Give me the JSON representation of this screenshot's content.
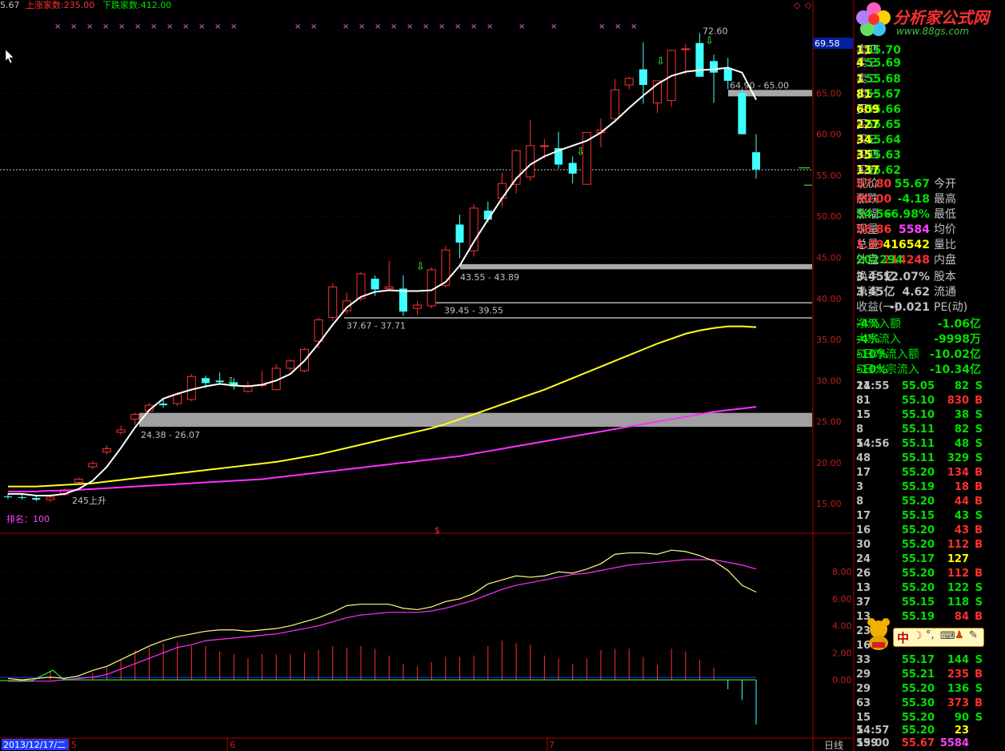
{
  "top_left": {
    "value": "5.67",
    "rise_label": "上涨家数:",
    "rise_value": "235.00",
    "fall_label": "下跌家数:",
    "fall_value": "412.00"
  },
  "logo": {
    "title": "分析家公式网",
    "url": "www.88gs.com"
  },
  "price_axis": {
    "current_box": "69.58",
    "ticks": [
      "65.00",
      "60.00",
      "55.00",
      "50.00",
      "45.00",
      "40.00",
      "35.00",
      "30.00",
      "25.00",
      "20.00",
      "15.00"
    ]
  },
  "indicator_axis": {
    "ticks": [
      "8.00",
      "6.00",
      "4.00",
      "2.00",
      "0.00"
    ]
  },
  "annotations": {
    "peak": "72.60",
    "z1": "64.90 - 65.00",
    "z2": "43.55 - 43.89",
    "z3": "39.45 - 39.55",
    "z4": "37.67 - 37.71",
    "z5": "24.38 - 26.07",
    "rise_note": "245上升",
    "rank": "排名：100",
    "dollar": "$"
  },
  "bottom_bar": {
    "date": "2013/12/17/二",
    "m1": "5",
    "m2": "6",
    "m3": "7",
    "period": "日线"
  },
  "order_book": [
    {
      "label": "卖四",
      "price": "55.70",
      "vol": "11"
    },
    {
      "label": "卖三",
      "price": "55.69",
      "vol": "4"
    },
    {
      "label": "卖二",
      "price": "55.68",
      "vol": "1"
    },
    {
      "label": "卖一",
      "price": "55.67",
      "vol": "81"
    },
    {
      "label": "买一",
      "price": "55.66",
      "vol": "609"
    },
    {
      "label": "买二",
      "price": "55.65",
      "vol": "227"
    },
    {
      "label": "买三",
      "price": "55.64",
      "vol": "34"
    },
    {
      "label": "买四",
      "price": "55.63",
      "vol": "35"
    },
    {
      "label": "买五",
      "price": "55.62",
      "vol": "137"
    }
  ],
  "stats": [
    {
      "l1": "现价",
      "v1": "55.67",
      "l2": "今开",
      "v2": "57.80",
      "c1": "#00e000",
      "c2": "#ff3030"
    },
    {
      "l1": "涨跌",
      "v1": "-4.18",
      "l2": "最高",
      "v2": "60.00",
      "c1": "#00e000",
      "c2": "#ff3030"
    },
    {
      "l1": "涨幅",
      "v1": "-6.98%",
      "l2": "最低",
      "v2": "54.56",
      "c1": "#00e000",
      "c2": "#00e000"
    },
    {
      "l1": "现量",
      "v1": "5584",
      "l2": "均价",
      "v2": "56.86",
      "c1": "#ff40ff",
      "c2": "#ff3030"
    },
    {
      "l1": "总量",
      "v1": "416542",
      "l2": "量比",
      "v2": "1.39",
      "c1": "#ffff00",
      "c2": "#ff3030"
    },
    {
      "l1": "外盘",
      "v1": "214248",
      "l2": "内盘",
      "v2": "202294",
      "c1": "#ff3030",
      "c2": "#00e000"
    },
    {
      "l1": "换手",
      "v1": "12.07%",
      "l2": "股本",
      "v2": "3.45亿",
      "c1": "#c0c0c0",
      "c2": "#c0c0c0"
    },
    {
      "l1": "净资",
      "v1": "4.62",
      "l2": "流通",
      "v2": "3.45亿",
      "c1": "#c0c0c0",
      "c2": "#c0c0c0"
    },
    {
      "l1": "收益(一)",
      "v1": "-0.021",
      "l2": "PE(动)",
      "v2": "",
      "c1": "#c0c0c0",
      "c2": "#c0c0c0"
    }
  ],
  "fund_flow": [
    {
      "label": "净流入额",
      "value": "-1.06亿",
      "pct": "-4%"
    },
    {
      "label": "大宗流入",
      "value": "-9998万",
      "pct": "-4%"
    },
    {
      "label": "5日净流入额",
      "value": "-10.02亿",
      "pct": "-10%"
    },
    {
      "label": "5日大宗流入",
      "value": "-10.34亿",
      "pct": "-10%"
    }
  ],
  "ticks": [
    {
      "time": "14:55",
      "price": "55.05",
      "vol": "82",
      "side": "S",
      "extra": "21"
    },
    {
      "time": "",
      "price": "55.10",
      "vol": "830",
      "side": "B",
      "extra": "81"
    },
    {
      "time": "",
      "price": "55.10",
      "vol": "38",
      "side": "S",
      "extra": "15"
    },
    {
      "time": "",
      "price": "55.11",
      "vol": "82",
      "side": "S",
      "extra": "8"
    },
    {
      "time": "14:56",
      "price": "55.11",
      "vol": "48",
      "side": "S",
      "extra": "5"
    },
    {
      "time": "",
      "price": "55.11",
      "vol": "329",
      "side": "S",
      "extra": "48"
    },
    {
      "time": "",
      "price": "55.20",
      "vol": "134",
      "side": "B",
      "extra": "17"
    },
    {
      "time": "",
      "price": "55.19",
      "vol": "18",
      "side": "B",
      "extra": "3"
    },
    {
      "time": "",
      "price": "55.20",
      "vol": "44",
      "side": "B",
      "extra": "8"
    },
    {
      "time": "",
      "price": "55.15",
      "vol": "43",
      "side": "S",
      "extra": "17"
    },
    {
      "time": "",
      "price": "55.20",
      "vol": "43",
      "side": "B",
      "extra": "16"
    },
    {
      "time": "",
      "price": "55.20",
      "vol": "112",
      "side": "B",
      "extra": "30"
    },
    {
      "time": "",
      "price": "55.17",
      "vol": "127",
      "side": "",
      "extra": "24"
    },
    {
      "time": "",
      "price": "55.20",
      "vol": "112",
      "side": "B",
      "extra": "26"
    },
    {
      "time": "",
      "price": "55.20",
      "vol": "122",
      "side": "S",
      "extra": "13"
    },
    {
      "time": "",
      "price": "55.15",
      "vol": "118",
      "side": "S",
      "extra": "37"
    },
    {
      "time": "",
      "price": "55.19",
      "vol": "84",
      "side": "B",
      "extra": "13"
    },
    {
      "time": "",
      "price": "",
      "vol": "",
      "side": "",
      "extra": "23"
    },
    {
      "time": "",
      "price": "",
      "vol": "",
      "side": "",
      "extra": "16"
    },
    {
      "time": "",
      "price": "55.17",
      "vol": "144",
      "side": "S",
      "extra": "33"
    },
    {
      "time": "",
      "price": "55.21",
      "vol": "235",
      "side": "B",
      "extra": "29"
    },
    {
      "time": "",
      "price": "55.20",
      "vol": "136",
      "side": "S",
      "extra": "29"
    },
    {
      "time": "",
      "price": "55.30",
      "vol": "373",
      "side": "B",
      "extra": "63"
    },
    {
      "time": "",
      "price": "55.20",
      "vol": "90",
      "side": "S",
      "extra": "15"
    },
    {
      "time": "14:57",
      "price": "55.20",
      "vol": "23",
      "side": "",
      "extra": "5"
    },
    {
      "time": "15:00",
      "price": "55.67",
      "vol": "5584",
      "side": "",
      "extra": "599"
    }
  ],
  "assistant": {
    "text": "中"
  },
  "chart_data": {
    "type": "candlestick",
    "price_range": [
      12,
      74
    ],
    "candles": [
      [
        15.9,
        16.3,
        15.6,
        15.8
      ],
      [
        15.8,
        16.2,
        15.5,
        15.7
      ],
      [
        15.7,
        16.0,
        15.3,
        15.5
      ],
      [
        15.5,
        15.9,
        15.2,
        15.8
      ],
      [
        16.1,
        16.8,
        16.0,
        16.7
      ],
      [
        17.6,
        18.2,
        17.4,
        18.0
      ],
      [
        19.5,
        20.2,
        19.2,
        19.9
      ],
      [
        21.3,
        22.1,
        21.0,
        21.7
      ],
      [
        23.7,
        24.5,
        23.4,
        24.0
      ],
      [
        25.3,
        26.1,
        24.6,
        25.9
      ],
      [
        26.3,
        27.3,
        26.0,
        27.0
      ],
      [
        27.2,
        27.8,
        26.7,
        27.0
      ],
      [
        27.2,
        28.6,
        26.9,
        28.3
      ],
      [
        27.7,
        30.8,
        27.5,
        30.5
      ],
      [
        30.3,
        30.6,
        29.1,
        29.7
      ],
      [
        30.0,
        31.0,
        29.5,
        29.8
      ],
      [
        29.8,
        30.3,
        28.9,
        29.3
      ],
      [
        28.7,
        29.9,
        28.5,
        29.4
      ],
      [
        29.4,
        31.2,
        29.2,
        29.5
      ],
      [
        28.9,
        32.0,
        28.8,
        31.5
      ],
      [
        31.5,
        32.6,
        31.2,
        32.4
      ],
      [
        31.2,
        34.0,
        31.0,
        33.8
      ],
      [
        34.8,
        37.7,
        33.9,
        37.4
      ],
      [
        37.7,
        41.8,
        37.3,
        41.4
      ],
      [
        38.5,
        40.7,
        38.1,
        39.7
      ],
      [
        40.0,
        43.2,
        39.7,
        43.0
      ],
      [
        42.4,
        42.8,
        40.3,
        41.1
      ],
      [
        41.2,
        44.6,
        40.9,
        41.4
      ],
      [
        41.2,
        42.8,
        37.9,
        38.4
      ],
      [
        38.8,
        39.7,
        38.0,
        39.2
      ],
      [
        39.1,
        43.8,
        38.8,
        43.5
      ],
      [
        41.6,
        46.4,
        41.3,
        45.9
      ],
      [
        49.0,
        50.2,
        44.9,
        46.8
      ],
      [
        45.8,
        51.5,
        45.1,
        51.0
      ],
      [
        50.7,
        51.8,
        49.3,
        49.6
      ],
      [
        52.2,
        55.3,
        51.1,
        54.0
      ],
      [
        53.9,
        58.2,
        52.8,
        58.0
      ],
      [
        54.8,
        61.7,
        54.3,
        58.6
      ],
      [
        58.6,
        59.4,
        57.0,
        58.6
      ],
      [
        58.3,
        60.3,
        55.8,
        56.3
      ],
      [
        56.5,
        57.3,
        54.0,
        55.2
      ],
      [
        53.9,
        58.6,
        53.9,
        60.2
      ],
      [
        60.2,
        61.9,
        58.4,
        60.5
      ],
      [
        61.9,
        66.7,
        61.4,
        65.4
      ],
      [
        66.0,
        67.0,
        65.5,
        66.8
      ],
      [
        67.9,
        71.2,
        63.7,
        66.0
      ],
      [
        63.8,
        66.2,
        62.6,
        66.5
      ],
      [
        64.1,
        69.3,
        63.3,
        70.2
      ],
      [
        70.3,
        71.0,
        67.3,
        70.4
      ],
      [
        71.1,
        72.3,
        67.0,
        67.0
      ],
      [
        68.9,
        69.7,
        63.8,
        67.5
      ],
      [
        68.0,
        69.3,
        65.5,
        66.5
      ],
      [
        65.0,
        65.5,
        60.0,
        60.0
      ],
      [
        57.8,
        60.0,
        54.6,
        55.7
      ]
    ],
    "ma_white": [
      16.2,
      16.2,
      16.0,
      16.0,
      16.2,
      16.8,
      17.8,
      19.5,
      21.8,
      24.3,
      26.4,
      27.8,
      28.4,
      28.9,
      29.3,
      29.6,
      29.4,
      29.3,
      29.5,
      30.0,
      30.8,
      32.4,
      34.5,
      36.8,
      38.9,
      40.2,
      40.8,
      41.0,
      40.9,
      40.9,
      41.0,
      42.0,
      44.0,
      46.9,
      49.6,
      52.2,
      54.6,
      56.3,
      57.3,
      58.0,
      58.6,
      59.2,
      60.2,
      61.6,
      63.2,
      64.7,
      66.1,
      67.1,
      67.6,
      67.8,
      67.9,
      68.1,
      67.5,
      64.2
    ],
    "ma_yellow": [
      17.1,
      17.1,
      17.1,
      17.2,
      17.3,
      17.4,
      17.5,
      17.7,
      17.9,
      18.1,
      18.3,
      18.5,
      18.7,
      18.9,
      19.1,
      19.3,
      19.5,
      19.7,
      19.9,
      20.1,
      20.4,
      20.7,
      21.0,
      21.4,
      21.8,
      22.2,
      22.6,
      23.0,
      23.4,
      23.8,
      24.2,
      24.7,
      25.3,
      25.9,
      26.5,
      27.1,
      27.7,
      28.3,
      28.9,
      29.6,
      30.3,
      31.0,
      31.7,
      32.4,
      33.1,
      33.8,
      34.5,
      35.1,
      35.7,
      36.1,
      36.4,
      36.6,
      36.6,
      36.5
    ],
    "ma_magenta": [
      16.5,
      16.5,
      16.5,
      16.6,
      16.6,
      16.7,
      16.8,
      16.9,
      17.0,
      17.1,
      17.2,
      17.3,
      17.4,
      17.5,
      17.6,
      17.7,
      17.8,
      17.9,
      18.0,
      18.2,
      18.4,
      18.6,
      18.8,
      19.0,
      19.2,
      19.4,
      19.6,
      19.8,
      20.0,
      20.2,
      20.4,
      20.6,
      20.8,
      21.1,
      21.4,
      21.7,
      22.0,
      22.3,
      22.6,
      22.9,
      23.2,
      23.5,
      23.8,
      24.1,
      24.4,
      24.7,
      25.0,
      25.3,
      25.6,
      25.9,
      26.2,
      26.4,
      26.6,
      26.8
    ],
    "indicator_range": [
      -4.2,
      10.5
    ],
    "ind_line1": [
      0.1,
      0.0,
      0.1,
      0.2,
      0.1,
      0.3,
      0.7,
      1.0,
      1.5,
      2.0,
      2.5,
      2.9,
      3.2,
      3.4,
      3.6,
      3.7,
      3.7,
      3.6,
      3.7,
      3.8,
      4.0,
      4.3,
      4.6,
      5.0,
      5.5,
      5.6,
      5.6,
      5.6,
      5.3,
      5.2,
      5.4,
      5.8,
      6.0,
      6.4,
      7.1,
      7.4,
      7.7,
      7.6,
      7.7,
      8.0,
      7.9,
      8.2,
      8.6,
      9.3,
      9.4,
      9.4,
      9.3,
      9.6,
      9.5,
      9.2,
      8.8,
      8.1,
      7.0,
      6.5
    ],
    "ind_line2": [
      -0.1,
      -0.1,
      -0.1,
      -0.1,
      0.0,
      0.1,
      0.2,
      0.4,
      0.8,
      1.2,
      1.6,
      2.0,
      2.4,
      2.6,
      2.9,
      3.0,
      3.1,
      3.2,
      3.3,
      3.4,
      3.6,
      3.8,
      4.0,
      4.3,
      4.6,
      4.8,
      4.9,
      5.0,
      5.0,
      5.0,
      5.1,
      5.3,
      5.6,
      5.9,
      6.3,
      6.7,
      7.0,
      7.2,
      7.4,
      7.6,
      7.8,
      7.9,
      8.1,
      8.3,
      8.5,
      8.6,
      8.7,
      8.8,
      8.9,
      8.9,
      8.9,
      8.7,
      8.5,
      8.2
    ],
    "ind_bars": [
      0.0,
      0.0,
      0.1,
      0.6,
      0.1,
      0.3,
      0.5,
      0.9,
      1.5,
      2.2,
      2.4,
      2.7,
      2.8,
      2.5,
      2.5,
      2.1,
      1.9,
      1.6,
      1.9,
      1.9,
      1.9,
      2.0,
      2.2,
      2.5,
      2.4,
      2.5,
      2.3,
      1.8,
      1.2,
      1.0,
      1.3,
      1.7,
      1.7,
      1.8,
      2.5,
      2.9,
      2.7,
      2.6,
      1.8,
      1.6,
      1.2,
      1.6,
      2.2,
      2.3,
      2.3,
      1.7,
      1.1,
      2.3,
      2.1,
      1.5,
      0.9,
      -0.7,
      -1.5,
      -3.3
    ]
  }
}
